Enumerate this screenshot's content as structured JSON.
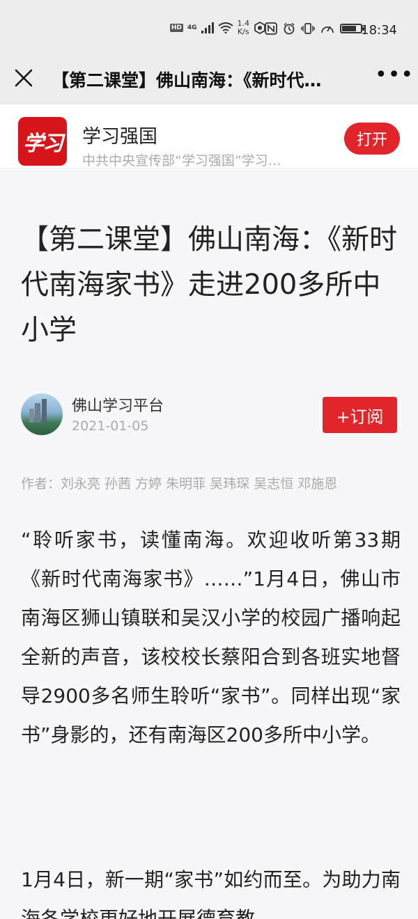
{
  "status_bar": {
    "hd": "HD",
    "signal": "4G",
    "speed_value": "1.4",
    "speed_unit": "K/s",
    "time": "18:34"
  },
  "nav": {
    "title": "【第二课堂】佛山南海：《新时代…",
    "more": "•••"
  },
  "app_banner": {
    "logo_text": "学习",
    "name": "学习强国",
    "description": "中共中央宣传部“学习强国”学习…",
    "open_label": "打开"
  },
  "article": {
    "title": "【第二课堂】佛山南海：《新时代南海家书》走进200多所中小学",
    "source_name": "佛山学习平台",
    "source_date": "2021-01-05",
    "subscribe_label": "+订阅",
    "byline": "作者：刘永亮 孙茜 方婷 朱明菲 吴玮琛 吴志恒 邓施恩",
    "paragraphs": [
      "“聆听家书，读懂南海。欢迎收听第33期《新时代南海家书》……”1月4日，佛山市南海区狮山镇联和吴汉小学的校园广播响起全新的声音，该校校长蔡阳合到各班实地督导2900多名师生聆听“家书”。同样出现“家书”身影的，还有南海区200多所中小学。",
      "1月4日，新一期“家书”如约而至。为助力南海各学校更好地开展德育教"
    ]
  }
}
